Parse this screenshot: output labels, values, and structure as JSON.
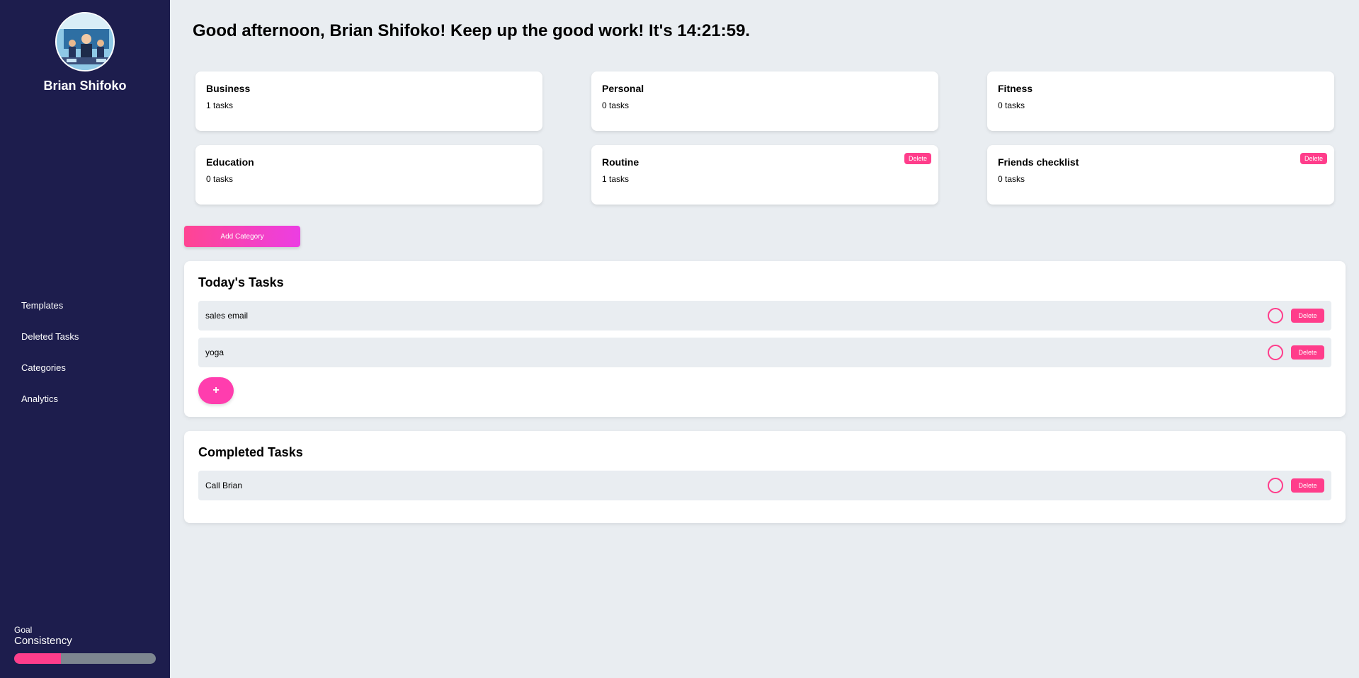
{
  "sidebar": {
    "profile_name": "Brian Shifoko",
    "nav": [
      "Templates",
      "Deleted Tasks",
      "Categories",
      "Analytics"
    ],
    "goal": {
      "label_line1": "Goal",
      "label_line2": "Consistency",
      "progress": 0.33
    }
  },
  "greeting": "Good afternoon, Brian Shifoko! Keep up the good work! It's 14:21:59.",
  "categories": [
    {
      "name": "Business",
      "count": "1 tasks"
    },
    {
      "name": "Personal",
      "count": "0 tasks"
    },
    {
      "name": "Fitness",
      "count": "0 tasks"
    },
    {
      "name": "Education",
      "count": "0 tasks"
    },
    {
      "name": "Routine",
      "count": "1 tasks",
      "delete_label": "Delete"
    },
    {
      "name": "Friends checklist",
      "count": "0 tasks",
      "delete_label": "Delete"
    }
  ],
  "add_category_label": "Add Category",
  "today": {
    "title": "Today's Tasks",
    "tasks": [
      {
        "name": "sales email",
        "delete_label": "Delete"
      },
      {
        "name": "yoga",
        "delete_label": "Delete"
      }
    ],
    "add_label": "+"
  },
  "completed": {
    "title": "Completed Tasks",
    "tasks": [
      {
        "name": "Call Brian",
        "delete_label": "Delete"
      }
    ]
  },
  "colors": {
    "sidebar": "#1d1d4d",
    "accent": "#ff3d8b",
    "background": "#e9edf1"
  }
}
